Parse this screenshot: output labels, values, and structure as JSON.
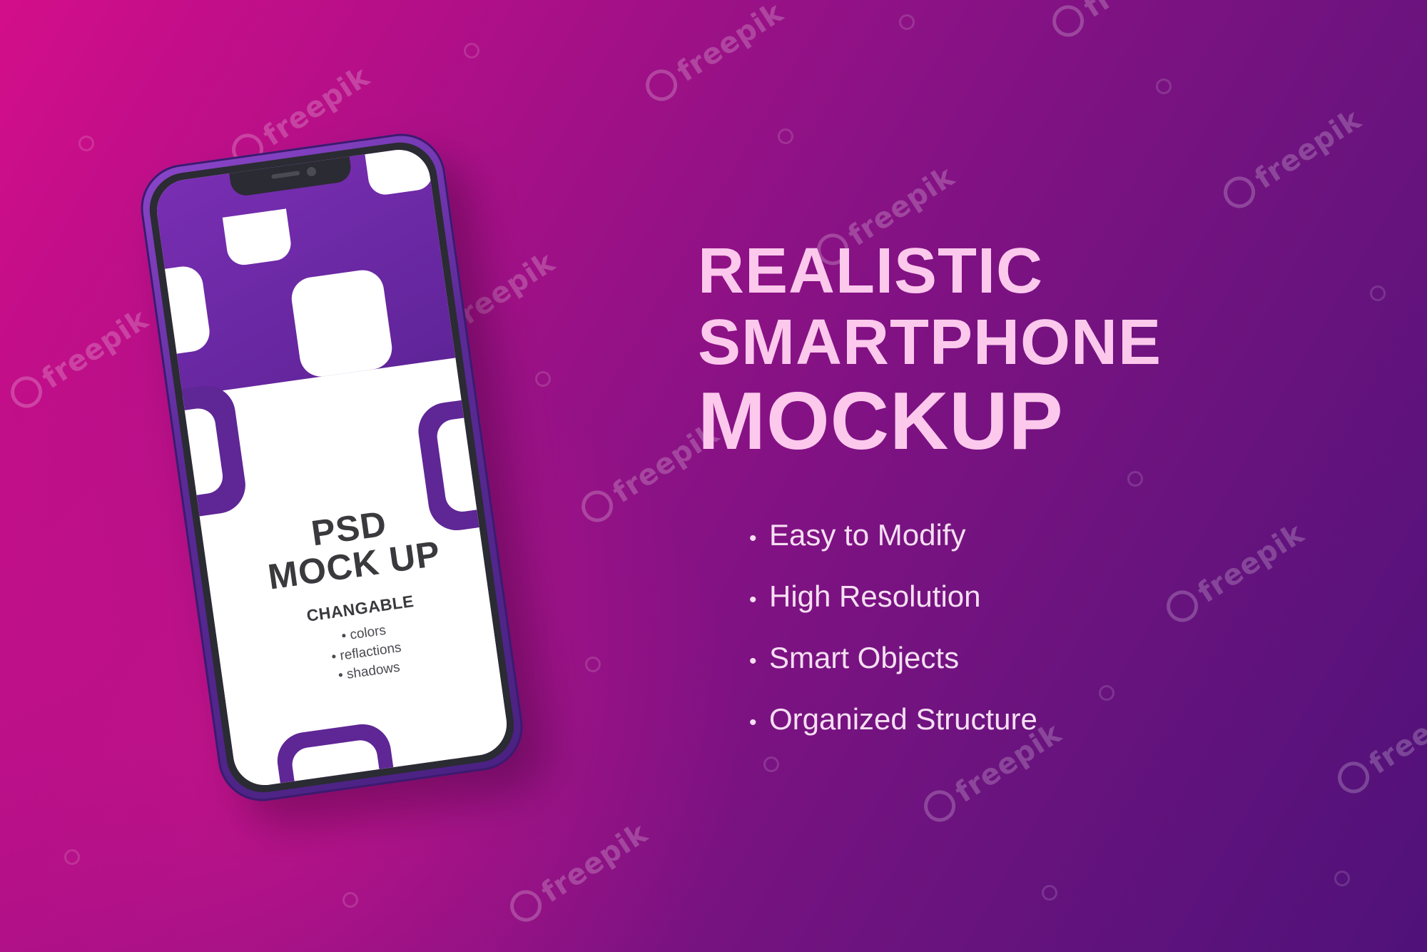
{
  "headline": {
    "line1": "REALISTIC",
    "line2": "SMARTPHONE",
    "line3": "MOCKUP"
  },
  "features": [
    "Easy to Modify",
    "High Resolution",
    "Smart Objects",
    "Organized Structure"
  ],
  "bullet": "•",
  "phone_screen": {
    "title_line1": "PSD",
    "title_line2": "MOCK UP",
    "subtitle": "CHANGABLE",
    "items": [
      "colors",
      "reflactions",
      "shadows"
    ]
  },
  "watermark": "freepik",
  "colors": {
    "background_start": "#d30e8a",
    "background_end": "#4f1279",
    "headline": "#fcc9ec",
    "features": "#f6dff2",
    "phone_frame": "#5b2a97",
    "screen_accent": "#5f2696"
  }
}
